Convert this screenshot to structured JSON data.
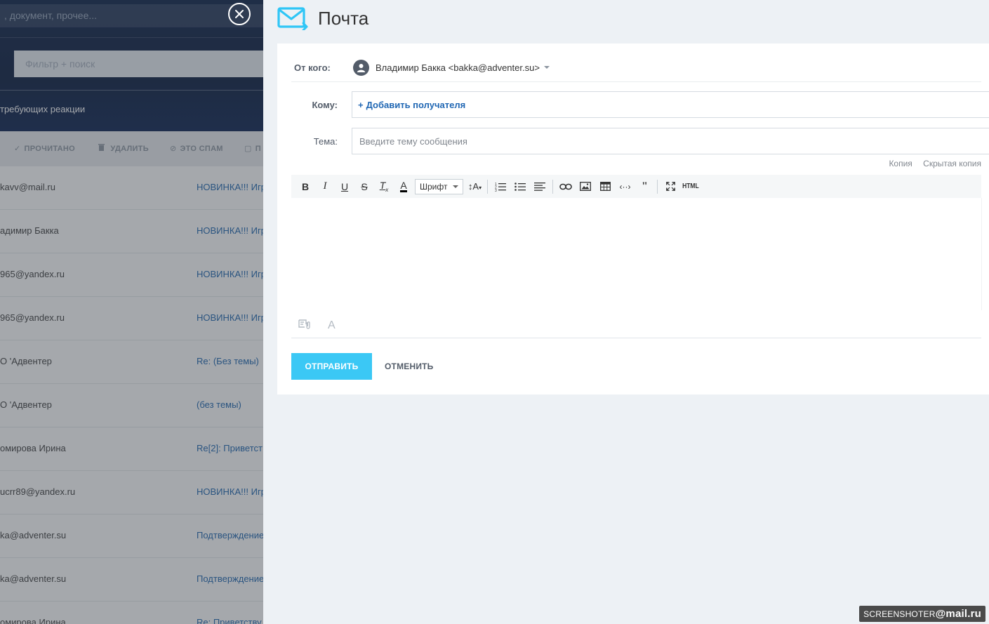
{
  "background": {
    "search_text": ", документ, прочее...",
    "filter_placeholder": "Фильтр + поиск",
    "counter_text": "требующих реакции",
    "actions": [
      {
        "label": "ПРОЧИТАНО",
        "icon": "check-icon"
      },
      {
        "label": "УДАЛИТЬ",
        "icon": "trash-icon"
      },
      {
        "label": "ЭТО СПАМ",
        "icon": "spam-icon"
      },
      {
        "label": "П",
        "icon": "folder-icon"
      }
    ],
    "rows": [
      {
        "from": "kavv@mail.ru",
        "subject": "НОВИНКА!!! Игр"
      },
      {
        "from": "адимир Бакка",
        "subject": "НОВИНКА!!! Игр"
      },
      {
        "from": "965@yandex.ru",
        "subject": "НОВИНКА!!! Игр"
      },
      {
        "from": "965@yandex.ru",
        "subject": "НОВИНКА!!! Игр"
      },
      {
        "from": "О 'Адвентер",
        "subject": "Re: (Без темы)"
      },
      {
        "from": "О 'Адвентер",
        "subject": "(без темы)"
      },
      {
        "from": "омирова Ирина",
        "subject": "Re[2]: Приветст"
      },
      {
        "from": "ucrr89@yandex.ru",
        "subject": "НОВИНКА!!! Игр"
      },
      {
        "from": "ka@adventer.su",
        "subject": "Подтверждение"
      },
      {
        "from": "ka@adventer.su",
        "subject": "Подтверждение"
      },
      {
        "from": "омирова Ирина",
        "subject": "Re: Приветству"
      }
    ]
  },
  "panel": {
    "title": "Почта",
    "from_label": "От кого:",
    "from_value": "Владимир Бакка <bakka@adventer.su>",
    "to_label": "Кому:",
    "add_recipient": "Добавить получателя",
    "add_recipient_plus": "+",
    "subject_label": "Тема:",
    "subject_placeholder": "Введите тему сообщения",
    "cc_label": "Копия",
    "bcc_label": "Скрытая копия",
    "font_select": "Шрифт",
    "html_label": "HTML",
    "send_label": "ОТПРАВИТЬ",
    "cancel_label": "ОТМЕНИТЬ"
  },
  "colors": {
    "accent": "#3bc8f5",
    "link": "#1f66b3",
    "panel_bg": "#edf1f5"
  },
  "watermark": {
    "left": "SCREENSHOTER",
    "right": "@mail.ru"
  }
}
